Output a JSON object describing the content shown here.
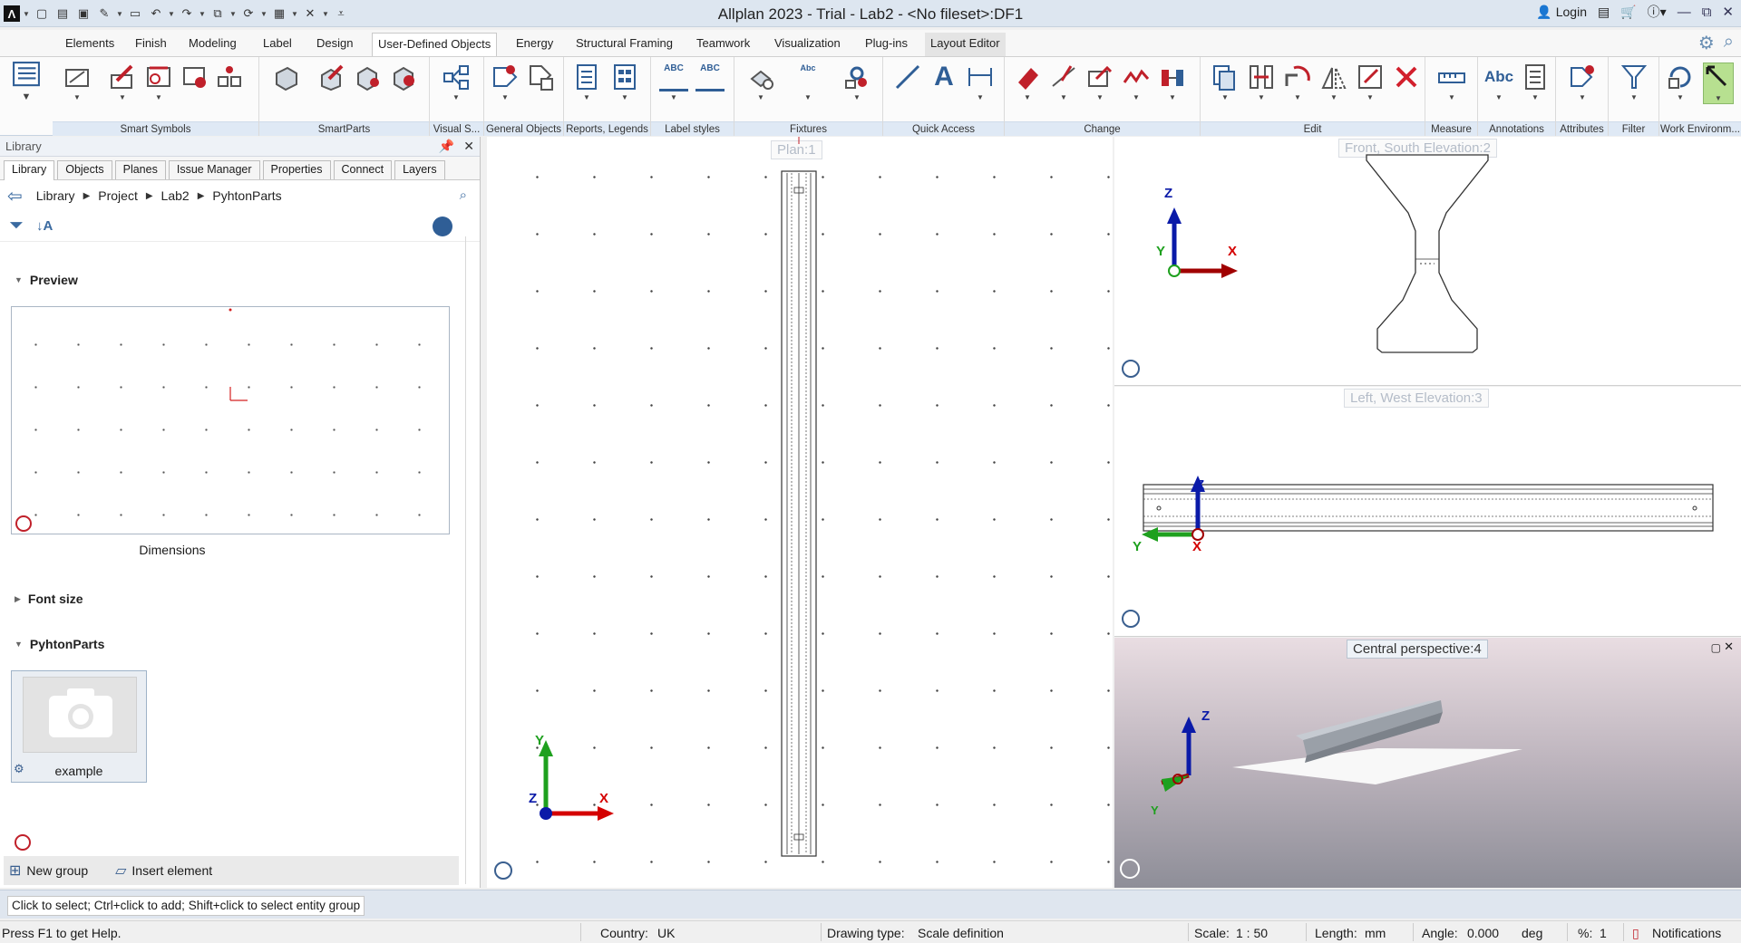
{
  "window": {
    "title": "Allplan 2023 - Trial - Lab2 - <No fileset>:DF1",
    "login_label": "Login"
  },
  "ribbon_tabs": [
    "Elements",
    "Finish",
    "Modeling",
    "Label",
    "Design",
    "User-Defined Objects",
    "Energy",
    "Structural Framing",
    "Teamwork",
    "Visualization",
    "Plug-ins",
    "Layout Editor"
  ],
  "active_tab": "User-Defined Objects",
  "ribbon_groups": [
    "Smart Symbols",
    "SmartParts",
    "Visual S...",
    "General Objects",
    "Reports, Legends",
    "Label styles",
    "Fixtures",
    "Quick Access",
    "Change",
    "Edit",
    "Measure",
    "Annotations",
    "Attributes",
    "Filter",
    "Work Environm..."
  ],
  "ribbon_icon_texts": {
    "abc1": "ABC",
    "abc2": "ABC",
    "abc3": "Abc",
    "quick_text": "A",
    "annot": "Abc"
  },
  "library": {
    "header": "Library",
    "tabs": [
      "Library",
      "Objects",
      "Planes",
      "Issue Manager",
      "Properties",
      "Connect",
      "Layers"
    ],
    "breadcrumb": [
      "Library",
      "Project",
      "Lab2",
      "PyhtonParts"
    ],
    "preview_title": "Preview",
    "dimensions_label": "Dimensions",
    "font_size_title": "Font size",
    "pythonparts_title": "PyhtonParts",
    "tile_name": "example",
    "new_group": "New group",
    "insert_element": "Insert element"
  },
  "viewports": {
    "plan": "Plan:1",
    "front": "Front, South Elevation:2",
    "left": "Left, West Elevation:3",
    "perspective": "Central perspective:4"
  },
  "axes": {
    "x": "X",
    "y": "Y",
    "z": "Z"
  },
  "command_hint": "Click to select; Ctrl+click to add; Shift+click to select entity group",
  "status": {
    "help": "Press F1 to get Help.",
    "country_label": "Country:",
    "country": "UK",
    "drawing_type_label": "Drawing type:",
    "drawing_type": "Scale definition",
    "scale_label": "Scale:",
    "scale": "1 : 50",
    "length_label": "Length:",
    "length": "mm",
    "angle_label": "Angle:",
    "angle": "0.000",
    "angle_unit": "deg",
    "percent_label": "%:",
    "percent": "1",
    "notifications": "Notifications"
  },
  "colors": {
    "ribbon_group_bg": "#dfe9f5",
    "axis_x": "#d40000",
    "axis_y": "#1ea01e",
    "axis_z": "#0a1aa8",
    "accent": "#3a6aa0"
  }
}
